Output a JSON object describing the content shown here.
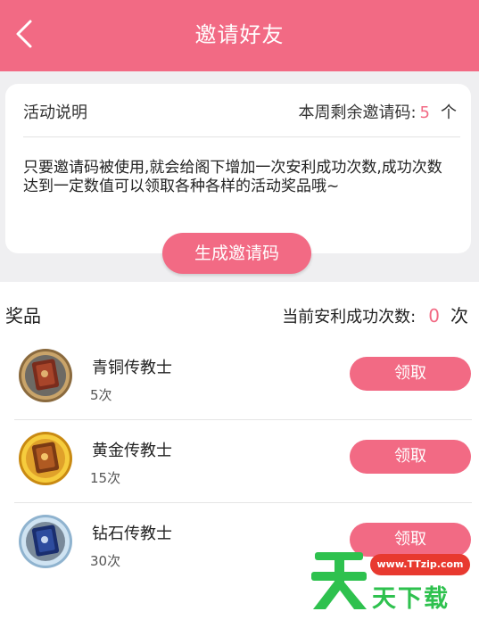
{
  "header": {
    "title": "邀请好友",
    "back_icon": "chevron-left-icon"
  },
  "activity": {
    "label": "活动说明",
    "remaining_label": "本周剩余邀请码:",
    "remaining_count": "5",
    "remaining_unit": "个",
    "description": "只要邀请码被使用,就会给阁下增加一次安利成功次数,成功次数达到一定数值可以领取各种各样的活动奖品哦~"
  },
  "generate_button": "生成邀请码",
  "prizes": {
    "title": "奖品",
    "count_label": "当前安利成功次数:",
    "count_value": "0",
    "count_unit": "次",
    "items": [
      {
        "name": "青铜传教士",
        "requirement": "5次",
        "button": "领取",
        "medal": "bronze-medal-icon"
      },
      {
        "name": "黄金传教士",
        "requirement": "15次",
        "button": "领取",
        "medal": "gold-medal-icon"
      },
      {
        "name": "钻石传教士",
        "requirement": "30次",
        "button": "领取",
        "medal": "diamond-medal-icon"
      }
    ]
  },
  "watermark": {
    "url": "www.TTzip.com",
    "text": "天下载",
    "logo": "tian-logo"
  },
  "colors": {
    "accent": "#f26a84",
    "background": "#efeff1",
    "watermark_green": "#2ec14e",
    "watermark_red": "#e8392f"
  }
}
